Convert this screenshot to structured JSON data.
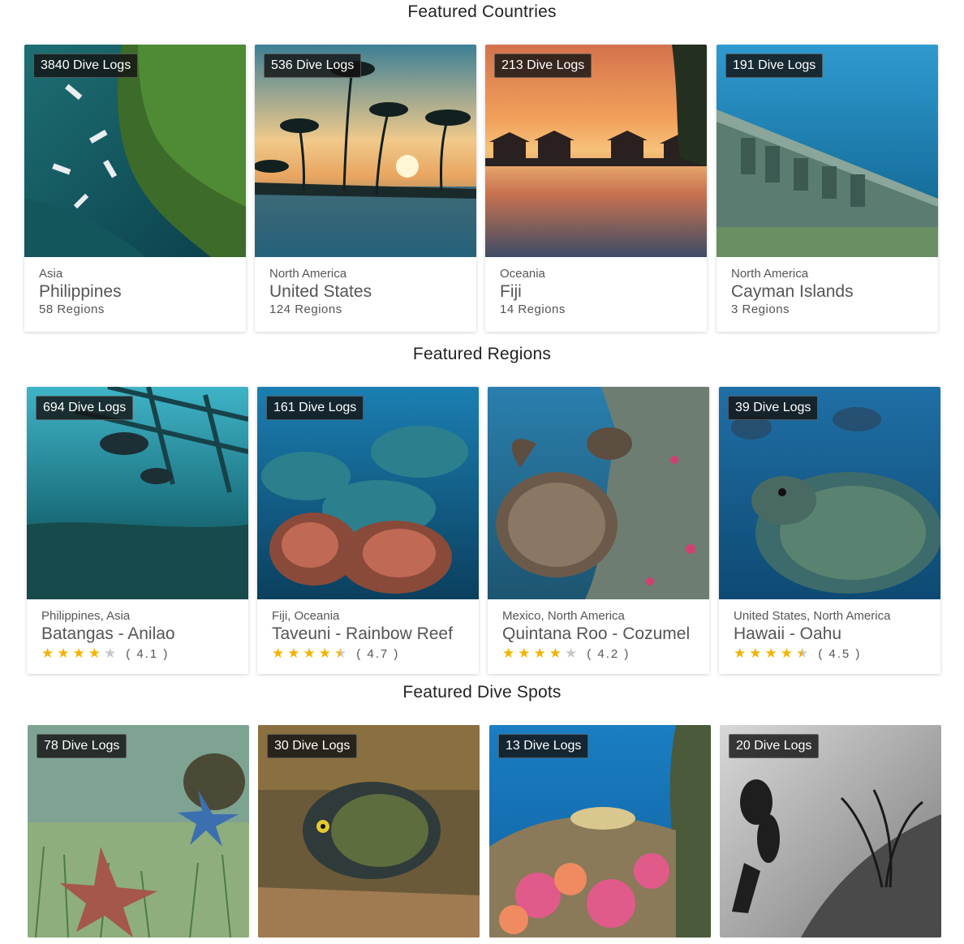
{
  "sections": {
    "countries": {
      "title": "Featured Countries",
      "cards": [
        {
          "badge": "3840 Dive Logs",
          "region": "Asia",
          "name": "Philippines",
          "sub": "58 Regions"
        },
        {
          "badge": "536 Dive Logs",
          "region": "North America",
          "name": "United States",
          "sub": "124 Regions"
        },
        {
          "badge": "213 Dive Logs",
          "region": "Oceania",
          "name": "Fiji",
          "sub": "14 Regions"
        },
        {
          "badge": "191 Dive Logs",
          "region": "North America",
          "name": "Cayman Islands",
          "sub": "3 Regions"
        }
      ]
    },
    "regions": {
      "title": "Featured Regions",
      "cards": [
        {
          "badge": "694 Dive Logs",
          "region": "Philippines, Asia",
          "name": "Batangas - Anilao",
          "rating_label": "( 4.1 )",
          "rating": 4.1
        },
        {
          "badge": "161 Dive Logs",
          "region": "Fiji, Oceania",
          "name": "Taveuni - Rainbow Reef",
          "rating_label": "( 4.7 )",
          "rating": 4.7
        },
        {
          "badge": "",
          "region": "Mexico, North America",
          "name": "Quintana Roo - Cozumel",
          "rating_label": "( 4.2 )",
          "rating": 4.2
        },
        {
          "badge": "39 Dive Logs",
          "region": "United States, North America",
          "name": "Hawaii - Oahu",
          "rating_label": "( 4.5 )",
          "rating": 4.5
        }
      ]
    },
    "spots": {
      "title": "Featured Dive Spots",
      "cards": [
        {
          "badge": "78 Dive Logs"
        },
        {
          "badge": "30 Dive Logs"
        },
        {
          "badge": "13 Dive Logs"
        },
        {
          "badge": "20 Dive Logs"
        }
      ]
    }
  },
  "photos": {
    "countries": [
      "aerial-reef-boats",
      "palm-sunset",
      "overwater-bungalows-sunset",
      "cayman-wreck-letters"
    ],
    "regions": [
      "shipwreck-divers",
      "coral-reef",
      "hawksbill-turtle",
      "green-turtle"
    ],
    "spots": [
      "starfish-seagrass",
      "french-angelfish",
      "soft-coral-reef",
      "diver-bw"
    ]
  },
  "colors": {
    "star": "#f5b301",
    "badge_bg": "#141414"
  }
}
